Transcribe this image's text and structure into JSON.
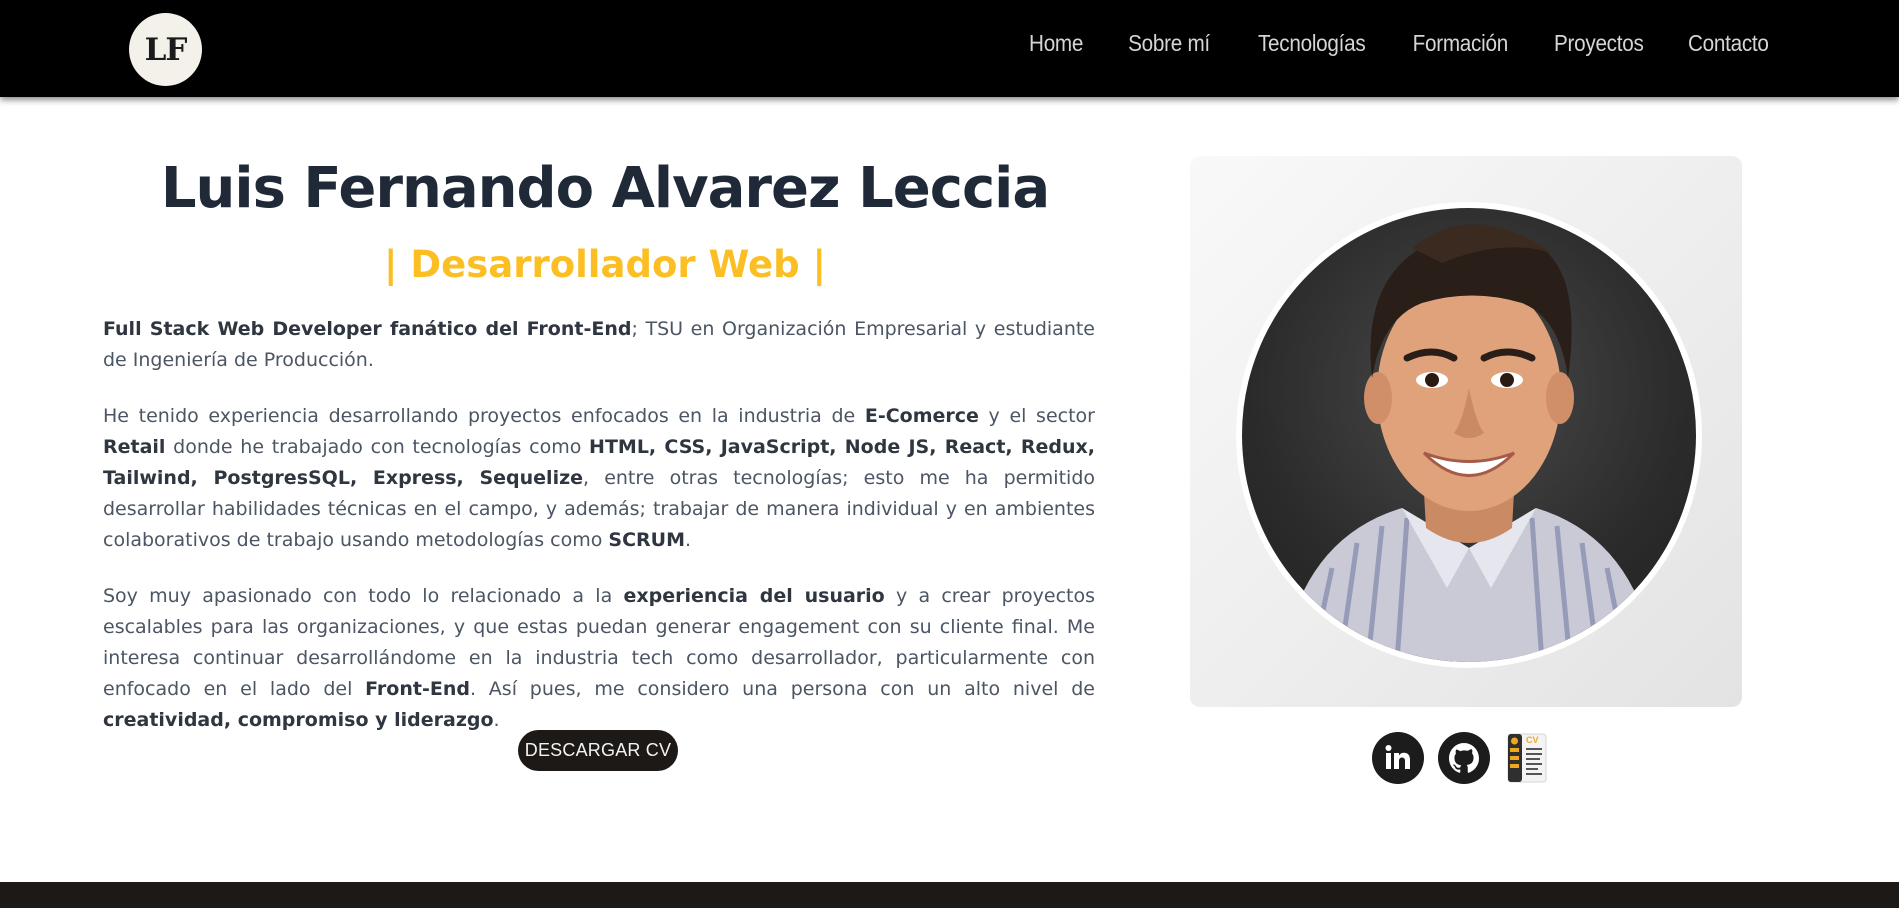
{
  "nav": {
    "logo": "LF",
    "links": [
      "Home",
      "Sobre mí",
      "Tecnologías",
      "Formación",
      "Proyectos",
      "Contacto"
    ]
  },
  "hero": {
    "name": "Luis Fernando Alvarez Leccia",
    "role": "| Desarrollador Web |",
    "p1": {
      "b1": "Full Stack Web Developer fanático del Front-End",
      "t1": "; TSU en Organización Empresarial y estudiante de Ingeniería de Producción."
    },
    "p2": {
      "t1": "He tenido experiencia desarrollando proyectos enfocados en la industria de ",
      "b1": "E-Comerce",
      "t2": " y el sector ",
      "b2": "Retail",
      "t3": " donde he trabajado con tecnologías como ",
      "b3": "HTML, CSS, JavaScript, Node JS, React, Redux, Tailwind, PostgresSQL, Express, Sequelize",
      "t4": ", entre otras tecnologías; esto me ha permitido desarrollar habilidades técnicas en el campo, y además; trabajar de manera individual y en ambientes colaborativos de trabajo usando metodologías como ",
      "b4": "SCRUM",
      "t5": "."
    },
    "p3": {
      "t1": "Soy muy apasionado con todo lo relacionado a la ",
      "b1": "experiencia del usuario",
      "t2": " y a crear proyectos escalables para las organizaciones, y que estas puedan generar engagement con su cliente final. Me interesa continuar desarrollándome en la industria tech como desarrollador, particularmente con enfocado en el lado del ",
      "b2": "Front-End",
      "t3": ". Así pues, me considero una persona con un alto nivel de ",
      "b3": "creatividad, compromiso y liderazgo",
      "t4": "."
    },
    "cv_button": "DESCARGAR CV"
  },
  "socials": [
    {
      "icon": "linkedin-icon"
    },
    {
      "icon": "github-icon"
    },
    {
      "icon": "cv-document-icon",
      "label": "CV"
    }
  ],
  "colors": {
    "navbar": "#000000",
    "accent": "#fbbf24",
    "heading": "#1f2937",
    "text": "#4b5563",
    "button": "#1c1917",
    "footer": "#1c1917"
  }
}
